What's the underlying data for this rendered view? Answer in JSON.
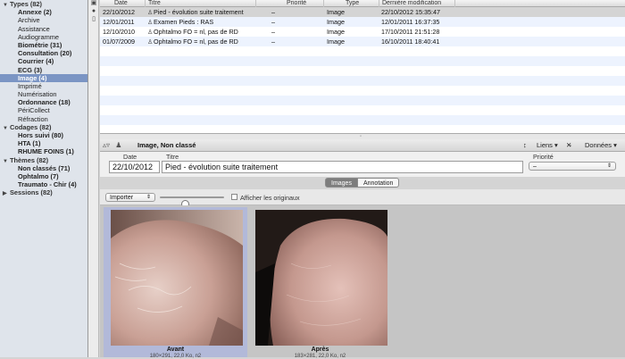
{
  "sidebar": {
    "rows": [
      {
        "label": "Types (82)",
        "kind": "group"
      },
      {
        "label": "Annexe (2)",
        "kind": "bold"
      },
      {
        "label": "Archive",
        "kind": "normal"
      },
      {
        "label": "Assistance",
        "kind": "normal"
      },
      {
        "label": "Audiogramme",
        "kind": "normal"
      },
      {
        "label": "Biométrie (31)",
        "kind": "bold"
      },
      {
        "label": "Consultation (20)",
        "kind": "bold"
      },
      {
        "label": "Courrier (4)",
        "kind": "bold"
      },
      {
        "label": "ECG (3)",
        "kind": "bold"
      },
      {
        "label": "Image (4)",
        "kind": "selected"
      },
      {
        "label": "Imprimé",
        "kind": "normal"
      },
      {
        "label": "Numérisation",
        "kind": "normal"
      },
      {
        "label": "Ordonnance (18)",
        "kind": "bold"
      },
      {
        "label": "PériCollect",
        "kind": "normal"
      },
      {
        "label": "Réfraction",
        "kind": "normal"
      },
      {
        "label": "Codages (82)",
        "kind": "group"
      },
      {
        "label": "Hors suivi (80)",
        "kind": "bold"
      },
      {
        "label": "HTA (1)",
        "kind": "bold"
      },
      {
        "label": "RHUME FOINS (1)",
        "kind": "bold"
      },
      {
        "label": "Thèmes (82)",
        "kind": "group"
      },
      {
        "label": "Non classés (71)",
        "kind": "bold"
      },
      {
        "label": "Ophtalmo (7)",
        "kind": "bold"
      },
      {
        "label": "Traumato - Chir (4)",
        "kind": "bold"
      },
      {
        "label": "Sessions (82)",
        "kind": "group-collapsed"
      }
    ]
  },
  "table": {
    "columns": [
      "Date",
      "Titre",
      "Priorité",
      "Type",
      "Dernière modification"
    ],
    "rows": [
      {
        "date": "22/10/2012",
        "title": "Pied - évolution suite traitement",
        "priority": "–",
        "type": "Image",
        "modified": "22/10/2012 15:35:47"
      },
      {
        "date": "12/01/2011",
        "title": "Examen Pieds : RAS",
        "priority": "–",
        "type": "Image",
        "modified": "12/01/2011 16:37:35"
      },
      {
        "date": "12/10/2010",
        "title": "Ophtalmo FO = nl, pas de RD",
        "priority": "–",
        "type": "Image",
        "modified": "17/10/2011 21:51:28"
      },
      {
        "date": "01/07/2009",
        "title": "Ophtalmo FO = nl, pas de RD",
        "priority": "–",
        "type": "Image",
        "modified": "16/10/2011 18:40:41"
      }
    ]
  },
  "detail": {
    "header_title": "Image, Non classé",
    "liens": "Liens",
    "donnees": "Données",
    "date_label": "Date",
    "titre_label": "Titre",
    "priorite_label": "Priorité",
    "date_value": "22/10/2012",
    "titre_value": "Pied - évolution suite traitement",
    "priorite_value": "–"
  },
  "tabs": {
    "images": "Images",
    "annotation": "Annotation"
  },
  "toolbar": {
    "import_label": "Importer",
    "show_originals": "Afficher les originaux",
    "zoom_level": 0.4
  },
  "gallery": {
    "items": [
      {
        "caption": "Avant",
        "sub": "180×291, 22,0 Ko, n2"
      },
      {
        "caption": "Après",
        "sub": "183×281, 22,0 Ko, n2"
      }
    ]
  },
  "colors": {
    "selection": "#7b95c4",
    "gallery_selection": "#b2b9d9",
    "row_alt": "#edf3fe"
  },
  "icons": [
    "disclosure-triangle-icon",
    "document-icon",
    "picture-icon",
    "sort-arrows-icon",
    "tools-icon"
  ]
}
